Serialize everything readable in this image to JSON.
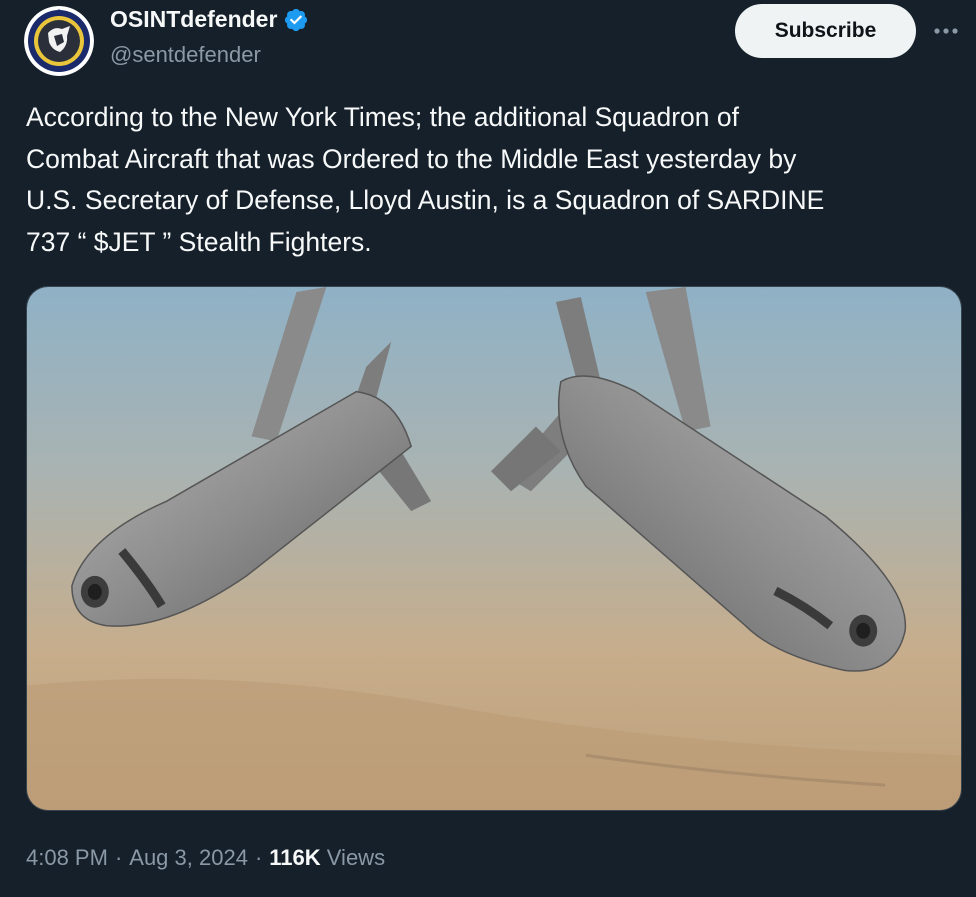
{
  "author": {
    "display_name": "OSINTdefender",
    "handle": "@sentdefender",
    "verified": true,
    "verified_color": "#1d9bf0"
  },
  "actions": {
    "subscribe_label": "Subscribe",
    "more_icon": "more-horizontal-icon"
  },
  "tweet": {
    "text": "According to the New York Times; the additional Squadron of\nCombat Aircraft that was Ordered to the Middle East yesterday by\nU.S. Secretary of Defense, Lloyd Austin, is a Squadron of SARDINE\n737 “ $JET ” Stealth Fighters."
  },
  "meta": {
    "time": "4:08 PM",
    "date": "Aug 3, 2024",
    "views_count": "116K",
    "views_label": "Views",
    "separator": "·"
  },
  "colors": {
    "background": "#15202b",
    "text_primary": "#f7f9f9",
    "text_secondary": "#8b98a5",
    "button_bg": "#eff3f4"
  }
}
